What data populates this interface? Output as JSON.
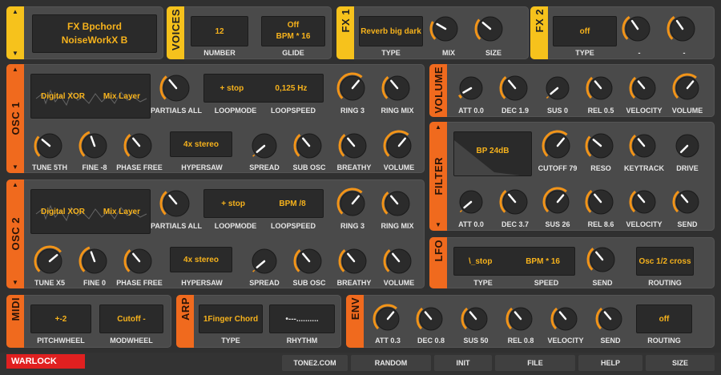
{
  "preset": {
    "line1": "FX Bpchord",
    "line2": "NoiseWorkX B"
  },
  "voices": {
    "title": "VOICES",
    "number": "12",
    "glide_top": "Off",
    "glide_bottom": "BPM * 16",
    "number_label": "NUMBER",
    "glide_label": "GLIDE"
  },
  "fx1": {
    "title": "FX 1",
    "type": "Reverb big dark",
    "type_label": "TYPE",
    "mix_label": "MIX",
    "size_label": "SIZE"
  },
  "fx2": {
    "title": "FX 2",
    "type": "off",
    "type_label": "TYPE",
    "k1_label": "-",
    "k2_label": "-"
  },
  "osc1": {
    "title": "OSC 1",
    "wave_left": "Digital XOR",
    "wave_right": "Mix Layer",
    "partials": "PARTIALS ALL",
    "loopmode": "+ stop",
    "loopspeed": "0,125 Hz",
    "loopmode_label": "LOOPMODE",
    "loopspeed_label": "LOOPSPEED",
    "ring": "RING 3",
    "ringmix": "RING MIX",
    "tune": "TUNE 5TH",
    "fine": "FINE -8",
    "phase": "PHASE FREE",
    "hypersaw": "4x stereo",
    "hypersaw_label": "HYPERSAW",
    "spread": "SPREAD",
    "subosc": "SUB OSC",
    "breathy": "BREATHY",
    "volume": "VOLUME"
  },
  "osc2": {
    "title": "OSC 2",
    "wave_left": "Digital XOR",
    "wave_right": "Mix Layer",
    "partials": "PARTIALS ALL",
    "loopmode": "+ stop",
    "loopspeed": "BPM /8",
    "loopmode_label": "LOOPMODE",
    "loopspeed_label": "LOOPSPEED",
    "ring": "RING 3",
    "ringmix": "RING MIX",
    "tune": "TUNE X5",
    "fine": "FINE 0",
    "phase": "PHASE FREE",
    "hypersaw": "4x stereo",
    "hypersaw_label": "HYPERSAW",
    "spread": "SPREAD",
    "subosc": "SUB OSC",
    "breathy": "BREATHY",
    "volume": "VOLUME"
  },
  "volume": {
    "title": "VOLUME",
    "att": "ATT 0.0",
    "dec": "DEC 1.9",
    "sus": "SUS 0",
    "rel": "REL 0.5",
    "velocity": "VELOCITY",
    "volume": "VOLUME"
  },
  "filter": {
    "title": "FILTER",
    "type": "BP 24dB",
    "cutoff": "CUTOFF 79",
    "reso": "RESO",
    "keytrack": "KEYTRACK",
    "drive": "DRIVE",
    "att": "ATT 0.0",
    "dec": "DEC 3.7",
    "sus": "SUS 26",
    "rel": "REL 8.6",
    "velocity": "VELOCITY",
    "send": "SEND"
  },
  "lfo": {
    "title": "LFO",
    "wave": "\\_stop",
    "speed_val": "BPM * 16",
    "type_label": "TYPE",
    "speed_label": "SPEED",
    "send_label": "SEND",
    "routing": "Osc 1/2 cross",
    "routing_label": "ROUTING"
  },
  "midi": {
    "title": "MIDI",
    "pitch": "+-2",
    "mod": "Cutoff -",
    "pitch_label": "PITCHWHEEL",
    "mod_label": "MODWHEEL"
  },
  "arp": {
    "title": "ARP",
    "type": "1Finger Chord",
    "rhythm": "•---..........",
    "type_label": "TYPE",
    "rhythm_label": "RHYTHM"
  },
  "env": {
    "title": "ENV",
    "att": "ATT 0.3",
    "dec": "DEC 0.8",
    "sus": "SUS 50",
    "rel": "REL 0.8",
    "velocity": "VELOCITY",
    "send": "SEND",
    "routing": "off",
    "routing_label": "ROUTING"
  },
  "bottom": {
    "brand": "WARLOCK",
    "site": "TONE2.COM",
    "random": "RANDOM",
    "init": "INIT",
    "file": "FILE",
    "help": "HELP",
    "size": "SIZE"
  },
  "colors": {
    "accent_yellow": "#f6c21c",
    "accent_orange": "#f06a1e",
    "lcd_text": "#f6b21c",
    "brand_red": "#e02020"
  }
}
